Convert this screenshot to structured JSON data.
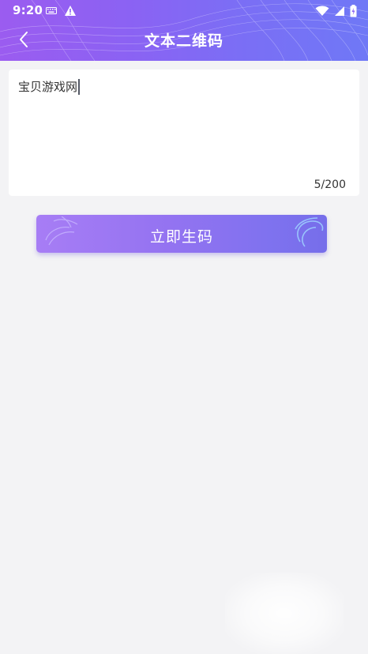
{
  "status_bar": {
    "time": "9:20",
    "icons": [
      "keyboard-icon",
      "warning-icon",
      "wifi-icon",
      "signal-icon",
      "battery-icon"
    ]
  },
  "header": {
    "title": "文本二维码",
    "back_icon": "chevron-left-icon",
    "gradient_colors": [
      "#9b5cf0",
      "#6f78f6"
    ]
  },
  "input": {
    "value": "宝贝游戏网",
    "char_count": "5/200"
  },
  "generate_button": {
    "label": "立即生码",
    "gradient_colors": [
      "#a77df5",
      "#766eea"
    ]
  }
}
